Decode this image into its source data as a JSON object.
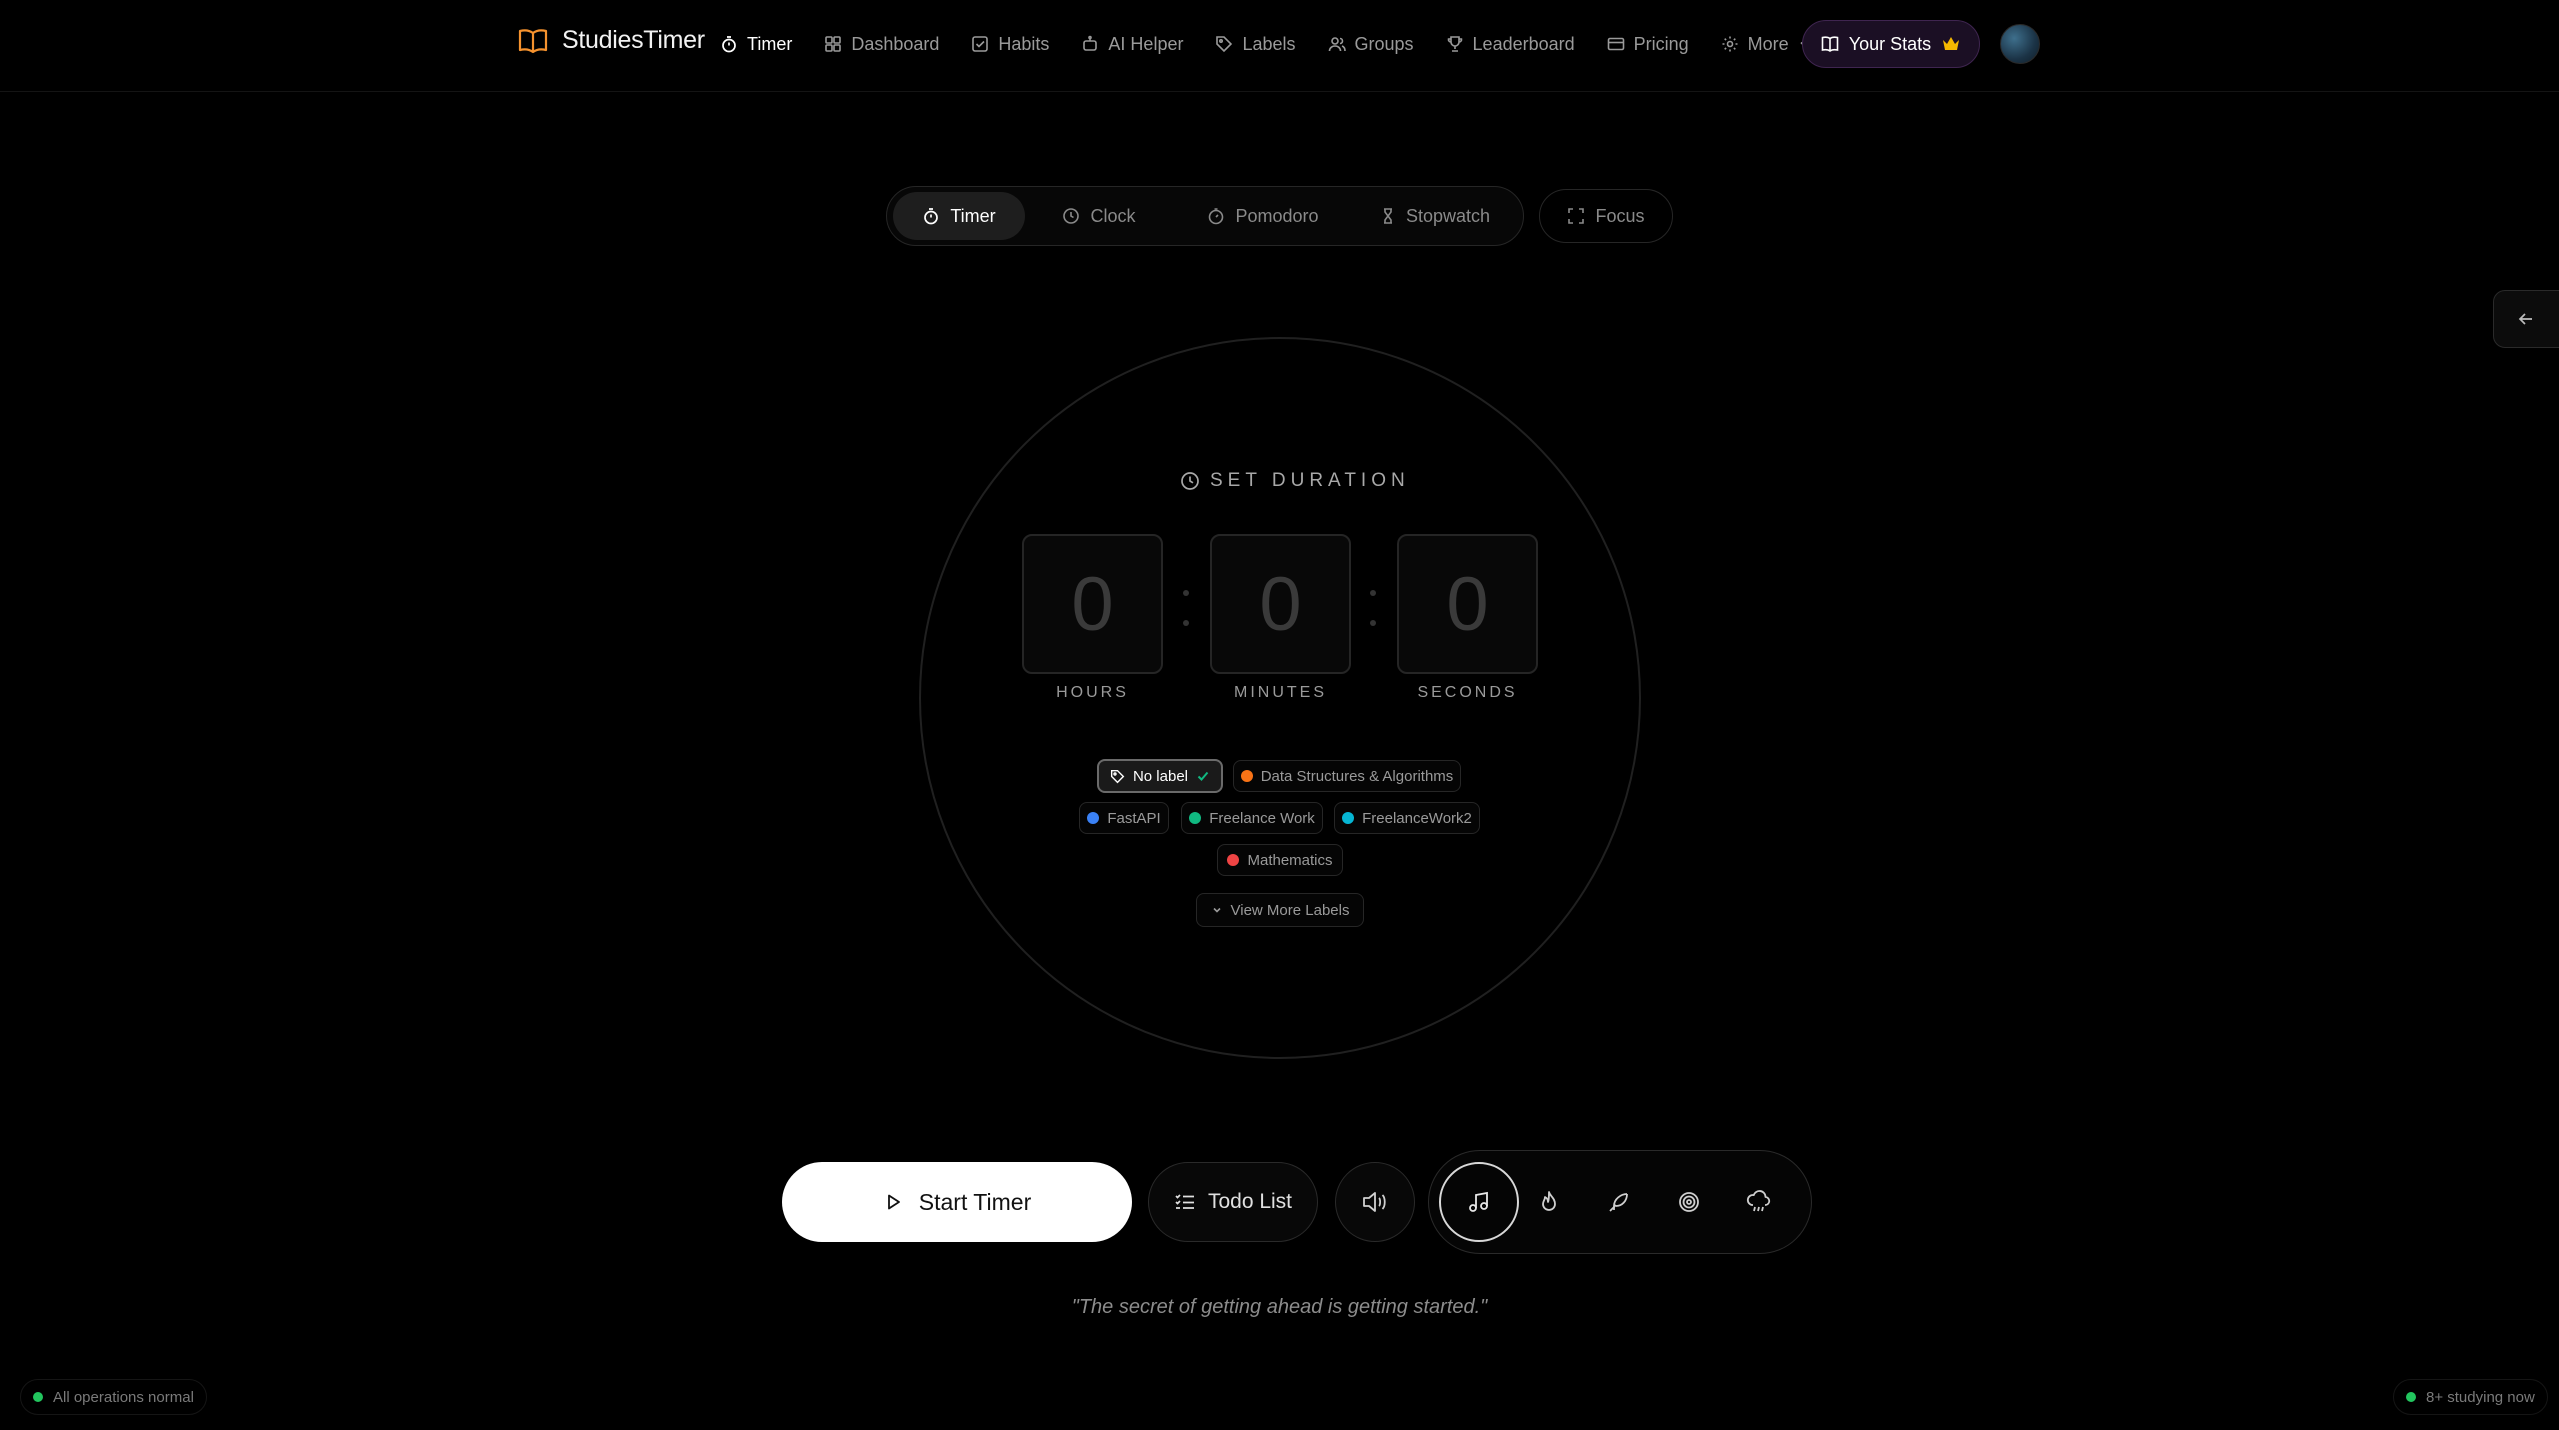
{
  "brand": {
    "name": "StudiesTimer",
    "accent": "#f5922e"
  },
  "nav": {
    "items": [
      {
        "label": "Timer",
        "icon": "stopwatch-icon",
        "active": true
      },
      {
        "label": "Dashboard",
        "icon": "dashboard-icon"
      },
      {
        "label": "Habits",
        "icon": "checkbox-icon"
      },
      {
        "label": "AI Helper",
        "icon": "robot-icon"
      },
      {
        "label": "Labels",
        "icon": "tag-icon"
      },
      {
        "label": "Groups",
        "icon": "users-icon"
      },
      {
        "label": "Leaderboard",
        "icon": "trophy-icon"
      },
      {
        "label": "Pricing",
        "icon": "card-icon"
      },
      {
        "label": "More",
        "icon": "gear-icon"
      }
    ],
    "stats_label": "Your Stats",
    "stats_icon": "crown-icon",
    "stats_icon_color": "#f5b800"
  },
  "modes": {
    "tabs": [
      {
        "label": "Timer",
        "active": true
      },
      {
        "label": "Clock"
      },
      {
        "label": "Pomodoro"
      },
      {
        "label": "Stopwatch"
      }
    ],
    "focus_label": "Focus"
  },
  "timer": {
    "heading": "SET DURATION",
    "hours": "0",
    "minutes": "0",
    "seconds": "0",
    "hours_label": "HOURS",
    "minutes_label": "MINUTES",
    "seconds_label": "SECONDS"
  },
  "labels": {
    "no_label": "No label",
    "items": [
      {
        "name": "Data Structures & Algorithms",
        "color": "#f97316"
      },
      {
        "name": "FastAPI",
        "color": "#3b82f6"
      },
      {
        "name": "Freelance Work",
        "color": "#10b981"
      },
      {
        "name": "FreelanceWork2",
        "color": "#06b6d4"
      },
      {
        "name": "Mathematics",
        "color": "#ef4444"
      }
    ],
    "view_more": "View More Labels"
  },
  "controls": {
    "start_label": "Start Timer",
    "todo_label": "Todo List",
    "sounds": [
      "music-icon",
      "fire-icon",
      "feather-icon",
      "spiral-icon",
      "rain-cloud-icon"
    ]
  },
  "quote": "\"The secret of getting ahead is getting started.\"",
  "status": {
    "operations": "All operations normal",
    "studying": "8+ studying now",
    "color": "#22c55e"
  }
}
